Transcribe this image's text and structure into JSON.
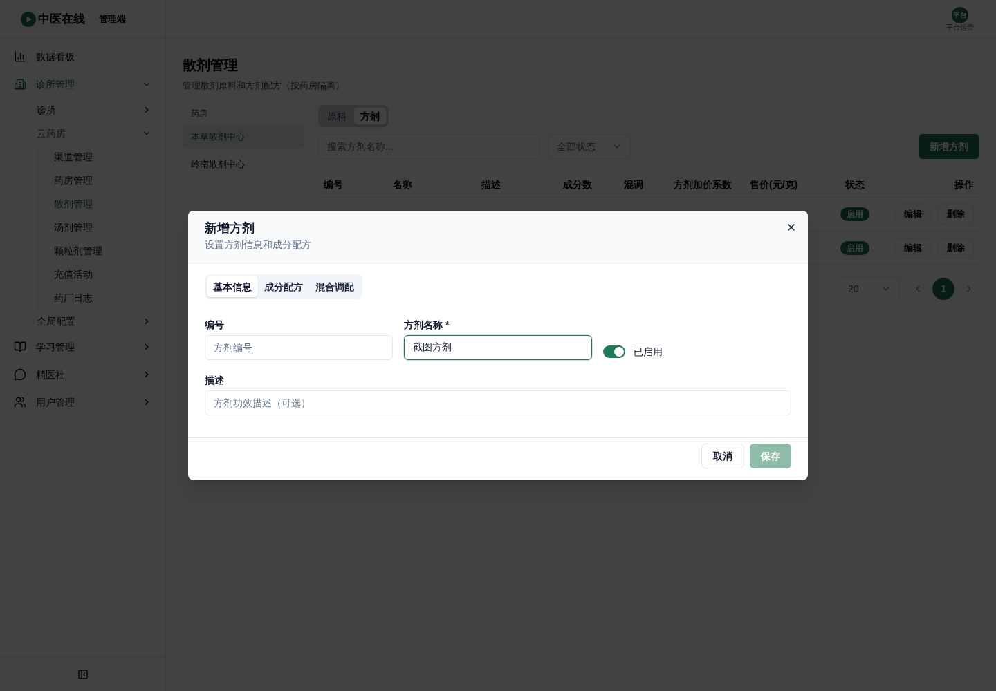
{
  "header": {
    "brand": "中医在线",
    "portal": "管理端",
    "user": {
      "avatar": "平台",
      "role": "平台运营"
    }
  },
  "sidebar": {
    "items": [
      {
        "label": "数据看板",
        "kind": "link",
        "selected": false
      },
      {
        "label": "诊所管理",
        "kind": "group",
        "expanded": true,
        "selected": false,
        "children": [
          {
            "label": "诊所",
            "kind": "group",
            "expanded": false,
            "selected": false
          },
          {
            "label": "云药房",
            "kind": "group",
            "expanded": true,
            "selected": false,
            "children": [
              {
                "label": "渠道管理",
                "kind": "link",
                "selected": false
              },
              {
                "label": "药房管理",
                "kind": "link",
                "selected": false
              },
              {
                "label": "散剂管理",
                "kind": "link",
                "selected": true
              },
              {
                "label": "汤剂管理",
                "kind": "link",
                "selected": false
              },
              {
                "label": "颗粒剂管理",
                "kind": "link",
                "selected": false
              },
              {
                "label": "充值活动",
                "kind": "link",
                "selected": false
              },
              {
                "label": "药厂日志",
                "kind": "link",
                "selected": false
              }
            ]
          },
          {
            "label": "全局配置",
            "kind": "group",
            "expanded": false,
            "selected": false
          }
        ]
      },
      {
        "label": "学习管理",
        "kind": "group",
        "expanded": false,
        "selected": false
      },
      {
        "label": "精医社",
        "kind": "group",
        "expanded": false,
        "selected": false
      },
      {
        "label": "用户管理",
        "kind": "group",
        "expanded": false,
        "selected": false
      }
    ]
  },
  "page": {
    "title": "散剂管理",
    "subtitle": "管理散剂原料和方剂配方（按药房隔离）"
  },
  "pharmacy_panel": {
    "heading": "药房",
    "items": [
      {
        "label": "本草散剂中心",
        "selected": true
      },
      {
        "label": "岭南散剂中心",
        "selected": false
      }
    ]
  },
  "type_tabs": [
    {
      "label": "原料",
      "selected": false
    },
    {
      "label": "方剂",
      "selected": true
    }
  ],
  "search": {
    "placeholder": "搜索方剂名称..."
  },
  "status_filter": {
    "value": "全部状态"
  },
  "add_button": {
    "label": "新增方剂"
  },
  "table": {
    "columns": [
      "编号",
      "名称",
      "描述",
      "成分数",
      "混调",
      "方剂加价系数",
      "售价(元/克)",
      "状态",
      "操作"
    ],
    "rows": [
      {
        "status": "启用",
        "enabled": true,
        "actions": [
          "编辑",
          "删除"
        ]
      },
      {
        "status": "启用",
        "enabled": true,
        "actions": [
          "编辑",
          "删除"
        ]
      }
    ]
  },
  "pagination": {
    "page_size": "20",
    "pages": [
      {
        "label": "1",
        "selected": true
      }
    ]
  },
  "dialog": {
    "title": "新增方剂",
    "subtitle": "设置方剂信息和成分配方",
    "tabs": [
      {
        "label": "基本信息",
        "selected": true
      },
      {
        "label": "成分配方",
        "selected": false
      },
      {
        "label": "混合调配",
        "selected": false
      }
    ],
    "rows": [
      {
        "fields": [
          {
            "kind": "text",
            "label": "编号",
            "placeholder": "方剂编号",
            "focused": false
          },
          {
            "kind": "text",
            "label": "方剂名称",
            "required_mark": "*",
            "value": "截图方剂",
            "focused": true
          },
          {
            "kind": "switch",
            "label": "已启用",
            "on": true
          }
        ]
      },
      {
        "fields": [
          {
            "kind": "text",
            "label": "描述",
            "placeholder": "方剂功效描述（可选）",
            "focused": false
          }
        ]
      }
    ],
    "buttons": [
      {
        "label": "取消",
        "kind": "secondary",
        "disabled": false
      },
      {
        "label": "保存",
        "kind": "primary",
        "disabled": true
      }
    ]
  }
}
